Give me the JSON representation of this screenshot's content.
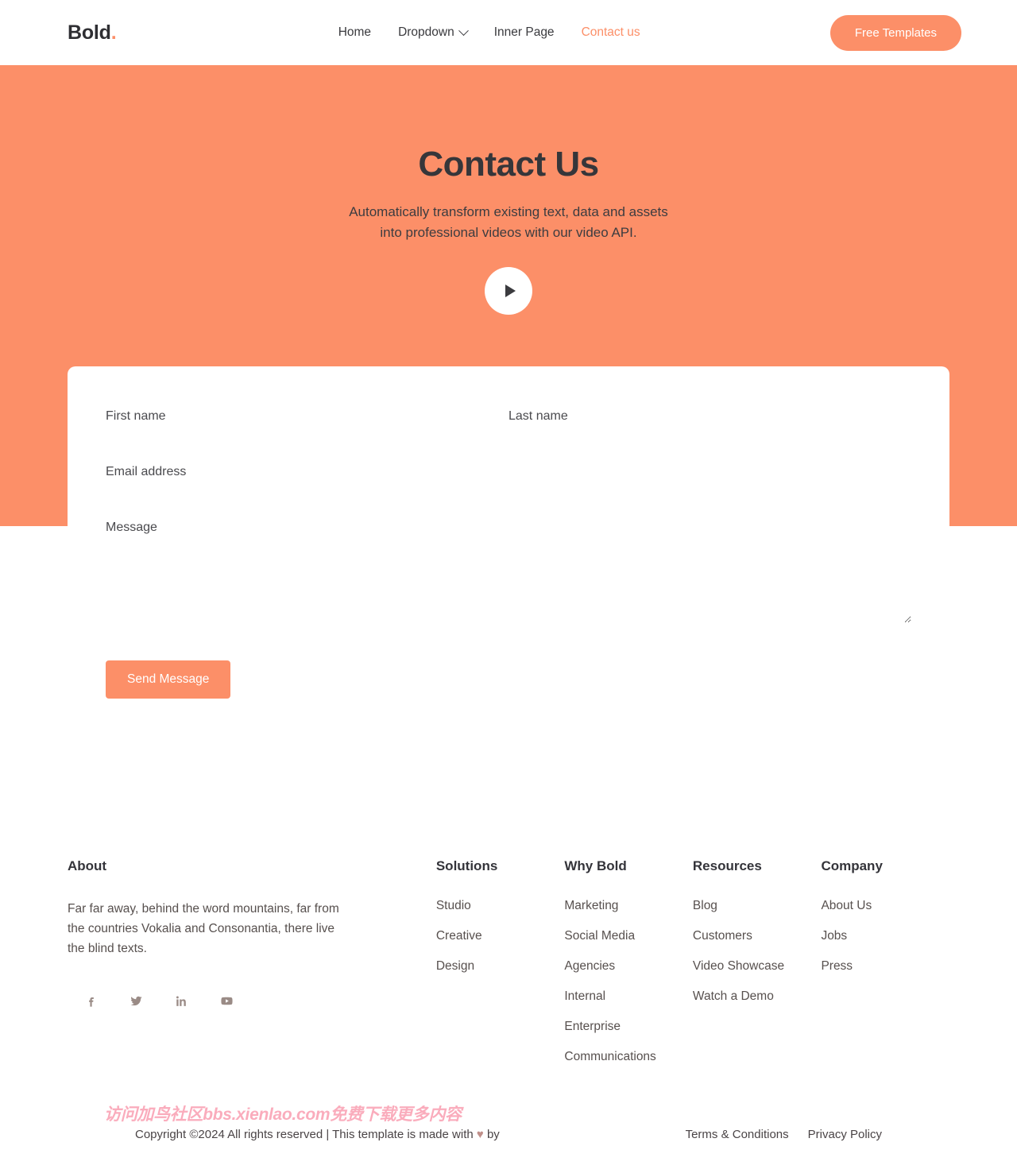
{
  "nav": {
    "logo": "Bold",
    "logo_dot": ".",
    "links": [
      {
        "label": "Home",
        "active": false,
        "has_chevron": false
      },
      {
        "label": "Dropdown",
        "active": false,
        "has_chevron": true
      },
      {
        "label": "Inner Page",
        "active": false,
        "has_chevron": false
      },
      {
        "label": "Contact us",
        "active": true,
        "has_chevron": false
      }
    ],
    "cta_label": "Free Templates"
  },
  "hero": {
    "title": "Contact Us",
    "subtitle": "Automatically transform existing text, data and assets into professional videos with our video API.",
    "play_icon": "play-icon"
  },
  "form": {
    "first_name": {
      "placeholder": "First name",
      "value": ""
    },
    "last_name": {
      "placeholder": "Last name",
      "value": ""
    },
    "email": {
      "placeholder": "Email address",
      "value": ""
    },
    "message": {
      "placeholder": "Message",
      "value": ""
    },
    "submit_label": "Send Message"
  },
  "footer": {
    "about": {
      "heading": "About",
      "text": "Far far away, behind the word mountains, far from the countries Vokalia and Consonantia, there live the blind texts.",
      "socials": [
        "facebook-icon",
        "twitter-icon",
        "linkedin-icon",
        "youtube-icon"
      ]
    },
    "columns": [
      {
        "heading": "Solutions",
        "links": [
          "Studio",
          "Creative",
          "Design"
        ]
      },
      {
        "heading": "Why Bold",
        "links": [
          "Marketing",
          "Social Media",
          "Agencies",
          "Internal",
          "Enterprise",
          "Communications"
        ]
      },
      {
        "heading": "Resources",
        "links": [
          "Blog",
          "Customers",
          "Video Showcase",
          "Watch a Demo"
        ]
      },
      {
        "heading": "Company",
        "links": [
          "About Us",
          "Jobs",
          "Press"
        ]
      }
    ]
  },
  "bottom": {
    "copyright_pre": "Copyright ©2024 All rights reserved | This template is made with ",
    "heart": "♥",
    "copyright_post": " by",
    "links": [
      "Terms & Conditions",
      "Privacy Policy"
    ],
    "watermark": "访问加鸟社区bbs.xienlao.com免费下载更多内容"
  },
  "colors": {
    "accent": "#fc8f68",
    "dark": "#36363a",
    "muted": "#57504e",
    "watermark": "#fa9aae"
  }
}
